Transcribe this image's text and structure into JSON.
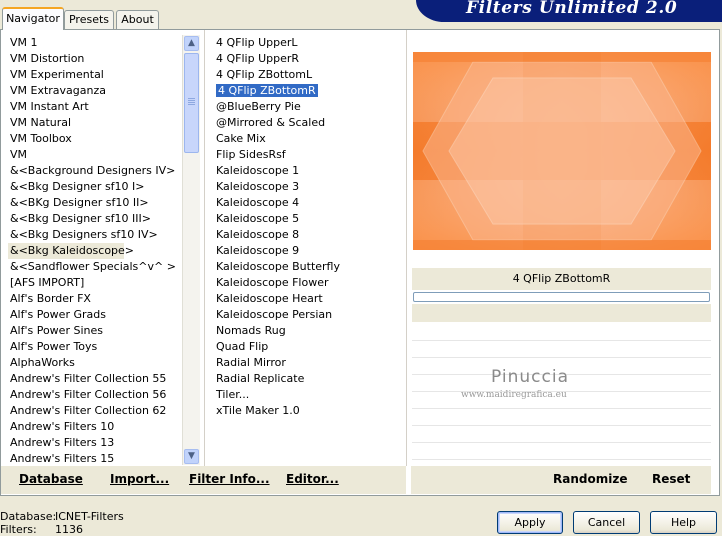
{
  "window": {
    "title": "Filters Unlimited 2.0"
  },
  "tabs": [
    {
      "label": "Navigator",
      "active": true
    },
    {
      "label": "Presets",
      "active": false
    },
    {
      "label": "About",
      "active": false
    }
  ],
  "categories": [
    "VM 1",
    "VM Distortion",
    "VM Experimental",
    "VM Extravaganza",
    "VM Instant Art",
    "VM Natural",
    "VM Toolbox",
    "VM",
    "&<Background Designers IV>",
    "&<Bkg Designer sf10 I>",
    "&<BKg Designer sf10 II>",
    "&<Bkg Designer sf10 III>",
    "&<Bkg Designers sf10 IV>",
    "&<Bkg Kaleidoscope>",
    "&<Sandflower Specials^v^ >",
    "[AFS IMPORT]",
    "Alf's Border FX",
    "Alf's Power Grads",
    "Alf's Power Sines",
    "Alf's Power Toys",
    "AlphaWorks",
    "Andrew's Filter Collection 55",
    "Andrew's Filter Collection 56",
    "Andrew's Filter Collection 62",
    "Andrew's Filters 10",
    "Andrew's Filters 13",
    "Andrew's Filters 15"
  ],
  "selected_category": "&<Bkg Kaleidoscope>",
  "filters": [
    "4 QFlip UpperL",
    "4 QFlip UpperR",
    "4 QFlip ZBottomL",
    "4 QFlip ZBottomR",
    "@BlueBerry Pie",
    "@Mirrored & Scaled",
    "Cake Mix",
    "Flip SidesRsf",
    "Kaleidoscope 1",
    "Kaleidoscope 3",
    "Kaleidoscope 4",
    "Kaleidoscope 5",
    "Kaleidoscope 8",
    "Kaleidoscope 9",
    "Kaleidoscope Butterfly",
    "Kaleidoscope Flower",
    "Kaleidoscope Heart",
    "Kaleidoscope Persian",
    "Nomads Rug",
    "Quad Flip",
    "Radial Mirror",
    "Radial Replicate",
    "Tiler...",
    "xTile Maker 1.0"
  ],
  "selected_filter": "4 QFlip ZBottomR",
  "preview": {
    "filter_name": "4 QFlip ZBottomR",
    "progress": 0
  },
  "watermark": {
    "title": "Pinuccia",
    "url": "www.maidiregrafica.eu"
  },
  "left_buttons": {
    "database": "Database",
    "import": "Import...",
    "filter_info": "Filter Info...",
    "editor": "Editor..."
  },
  "right_buttons": {
    "randomize": "Randomize",
    "reset": "Reset"
  },
  "status": {
    "database_label": "Database:",
    "database_value": "ICNET-Filters",
    "filters_label": "Filters:",
    "filters_value": "1136"
  },
  "dialog_buttons": {
    "apply": "Apply",
    "cancel": "Cancel",
    "help": "Help"
  },
  "colors": {
    "selection": "#316ac5",
    "banner": "#0a1f7a",
    "preview_orange": "#f57b25"
  }
}
